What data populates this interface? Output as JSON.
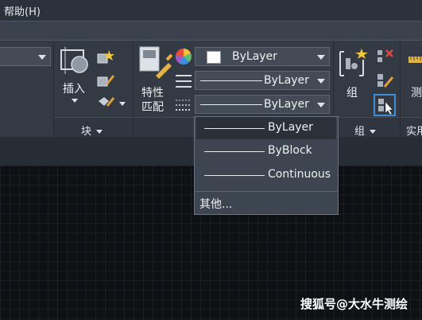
{
  "menubar": {
    "help": "帮助(H)"
  },
  "ribbon": {
    "block_panel": {
      "insert_label": "插入",
      "footer": "块"
    },
    "properties_panel": {
      "match_label_line1": "特性",
      "match_label_line2": "匹配",
      "color_combo": "ByLayer",
      "linetype_combo": "ByLayer",
      "lineweight_combo": "ByLayer"
    },
    "groups_panel": {
      "group_label": "组",
      "footer": "组"
    },
    "utilities_panel": {
      "measure_label": "测",
      "footer": "实用"
    }
  },
  "linetype_dropdown": {
    "options": [
      "ByLayer",
      "ByBlock",
      "Continuous"
    ],
    "selected": "ByLayer",
    "more": "其他..."
  },
  "watermark": "搜狐号@大水牛测绘",
  "colors": {
    "accent_blue": "#3f8fd8",
    "background": "#212830",
    "viewport": "#0e1013"
  }
}
